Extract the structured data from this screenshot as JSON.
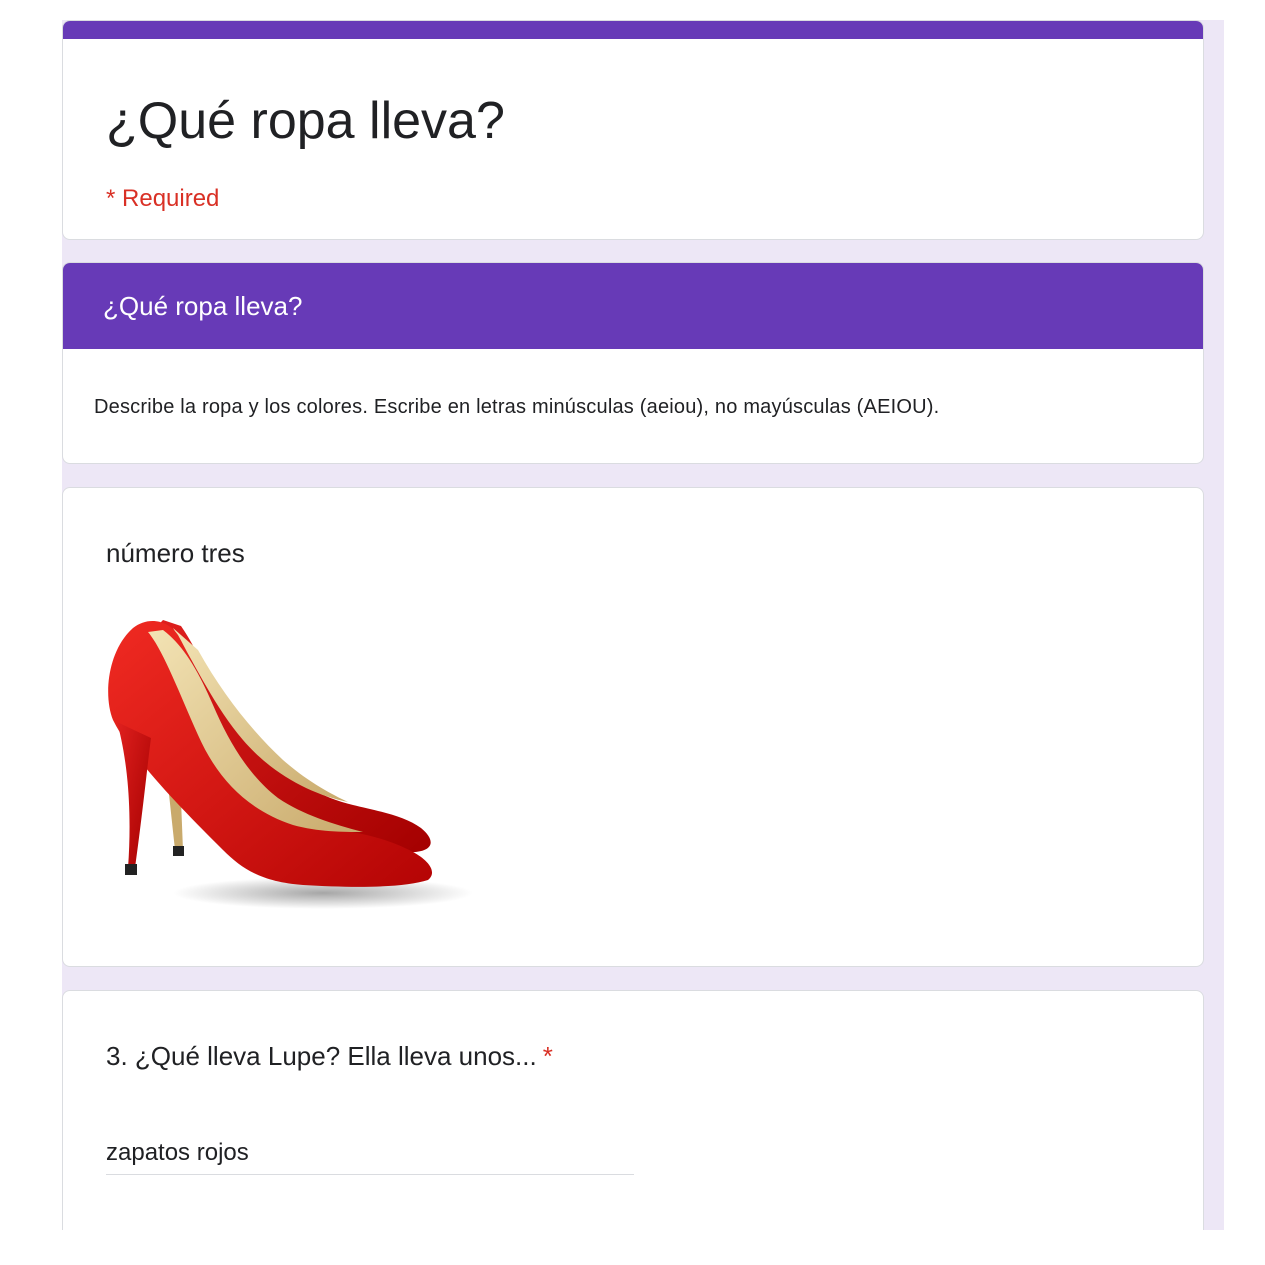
{
  "form": {
    "title": "¿Qué ropa lleva?",
    "required_note": "* Required"
  },
  "section": {
    "title": "¿Qué ropa lleva?",
    "description": "Describe la ropa y los colores. Escribe en letras minúsculas (aeiou), no mayúsculas (AEIOU)."
  },
  "image_item": {
    "title": "número tres",
    "image_semantic": "red-high-heel-shoes"
  },
  "question": {
    "title": "3. ¿Qué lleva Lupe? Ella lleva unos...",
    "required_marker": "*",
    "answer_value": "zapatos rojos"
  },
  "colors": {
    "theme": "#673ab7",
    "background": "#ede7f6",
    "required": "#d93025"
  }
}
